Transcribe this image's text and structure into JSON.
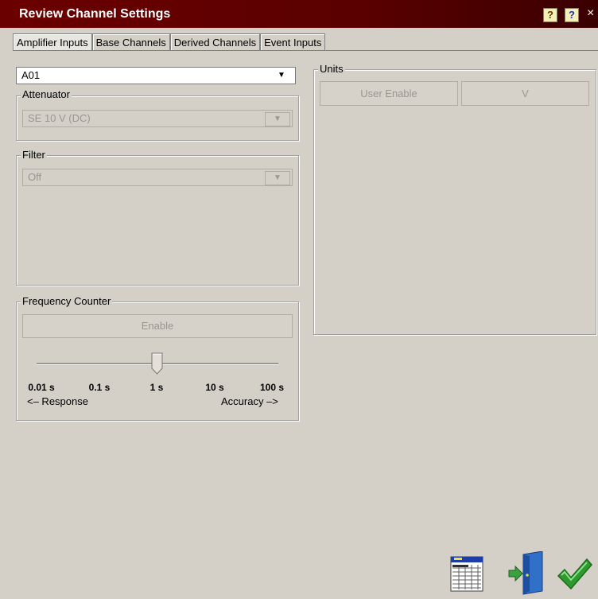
{
  "window": {
    "title": "Review Channel Settings",
    "help_q": "?",
    "help": "?",
    "close": "×"
  },
  "tabs": [
    {
      "label": "Amplifier Inputs",
      "active": true
    },
    {
      "label": "Base Channels"
    },
    {
      "label": "Derived Channels"
    },
    {
      "label": "Event Inputs"
    }
  ],
  "channel_select": {
    "value": "A01",
    "arrow": "▼"
  },
  "attenuator": {
    "label": "Attenuator",
    "value": "SE 10 V (DC)",
    "arrow": "▼"
  },
  "filter": {
    "label": "Filter",
    "value": "Off",
    "arrow": "▼"
  },
  "frequency_counter": {
    "label": "Frequency Counter",
    "enable": "Enable",
    "ticks": [
      "0.01 s",
      "0.1 s",
      "1 s",
      "10 s",
      "100 s"
    ],
    "selected_tick": "1 s",
    "left_hint": "<– Response",
    "right_hint": "Accuracy –>"
  },
  "units": {
    "label": "Units",
    "user_enable": "User Enable",
    "value": "V"
  },
  "colors": {
    "titlebar": "#5a0000",
    "face": "#d4d0c8",
    "check": "#2e9a2e",
    "door": "#3070c8"
  },
  "icons": [
    "spreadsheet-icon",
    "exit-door-icon",
    "checkmark-icon"
  ]
}
